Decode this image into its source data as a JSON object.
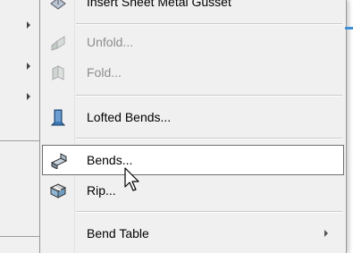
{
  "menu": {
    "items": [
      {
        "label": "Insert Sheet Metal Gusset",
        "icon": "gusset-icon",
        "enabled": true
      },
      {
        "label": "Unfold...",
        "icon": "unfold-icon",
        "enabled": false
      },
      {
        "label": "Fold...",
        "icon": "fold-icon",
        "enabled": false
      },
      {
        "label": "Lofted Bends...",
        "icon": "lofted-bends-icon",
        "enabled": true
      },
      {
        "label": "Bends...",
        "icon": "bends-icon",
        "enabled": true,
        "hovered": true
      },
      {
        "label": "Rip...",
        "icon": "rip-icon",
        "enabled": true
      },
      {
        "label": "Bend Table",
        "icon": "",
        "enabled": true,
        "has_submenu": true
      }
    ]
  },
  "colors": {
    "menu_bg": "#f0f0f0",
    "hover_bg": "#ffffff",
    "hover_border": "#6e6e6e",
    "disabled_text": "#8d8d8d",
    "accent": "#3e8fd6"
  }
}
